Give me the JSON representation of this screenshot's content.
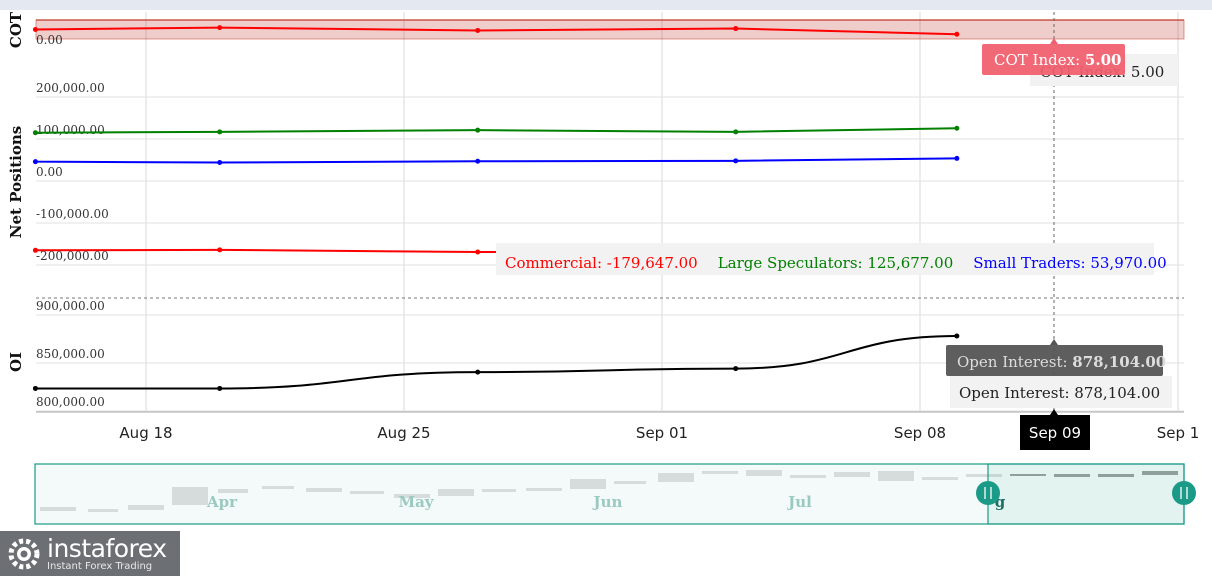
{
  "chart_data": {
    "type": "line",
    "x": [
      "2025-08-15",
      "2025-08-20",
      "2025-08-27",
      "2025-09-03",
      "2025-09-09"
    ],
    "x_ticks": [
      "Aug 18",
      "Aug 25",
      "Sep 01",
      "Sep 08",
      "Sep 1"
    ],
    "x_tick_dates": [
      "2025-08-18",
      "2025-08-25",
      "2025-09-01",
      "2025-09-08",
      "2025-09-15"
    ],
    "hover_label": "Sep 09",
    "panels": [
      {
        "id": "cot",
        "ylabel": "COT",
        "yticks": [
          "0.00"
        ],
        "ylim": [
          0,
          100
        ],
        "series": [
          {
            "name": "COT Index",
            "color": "#ff0000",
            "values": [
              10,
              12,
              9,
              11,
              5
            ]
          }
        ]
      },
      {
        "id": "net",
        "ylabel": "Net Positions",
        "yticks": [
          "200,000.00",
          "100,000.00",
          "0.00",
          "-100,000.00",
          "-200,000.00"
        ],
        "ylim": [
          -200000,
          200000
        ],
        "series": [
          {
            "name": "Commercial",
            "color": "#ff0000",
            "values": [
              -165000,
              -164000,
              -169000,
              -170000,
              -179647
            ]
          },
          {
            "name": "Large Speculators",
            "color": "#008000",
            "values": [
              115000,
              117000,
              121000,
              117000,
              125677
            ]
          },
          {
            "name": "Small Traders",
            "color": "#0000ff",
            "values": [
              46000,
              44000,
              47000,
              48000,
              53970
            ]
          }
        ]
      },
      {
        "id": "oi",
        "ylabel": "OI",
        "yticks": [
          "900,000.00",
          "850,000.00",
          "800,000.00"
        ],
        "ylim": [
          800000,
          900000
        ],
        "series": [
          {
            "name": "Open Interest",
            "color": "#000000",
            "values": [
              823500,
              823500,
              840500,
              844200,
              878104
            ]
          }
        ]
      }
    ]
  },
  "tooltips": {
    "cot_hover": {
      "label": "COT Index: ",
      "value": "5.00",
      "bg": "#f06070"
    },
    "cot_fixed": {
      "label": "COT Index: ",
      "value": "5.00"
    },
    "net_fixed": [
      {
        "label": "Commercial: ",
        "value": "-179,647.00",
        "color": "#ff0000"
      },
      {
        "label": "Large Speculators: ",
        "value": "125,677.00",
        "color": "#008000"
      },
      {
        "label": "Small Traders: ",
        "value": "53,970.00",
        "color": "#0000ff"
      }
    ],
    "oi_hover": {
      "label": "Open Interest: ",
      "value": "878,104.00",
      "bg": "#555555"
    },
    "oi_fixed": {
      "label": "Open Interest: ",
      "value": "878,104.00"
    }
  },
  "navigator": {
    "months": [
      "Apr",
      "May",
      "Jun",
      "Jul",
      "g"
    ],
    "accent": "#1a9a87"
  },
  "logo": {
    "name": "instaforex",
    "tagline": "Instant Forex Trading"
  }
}
